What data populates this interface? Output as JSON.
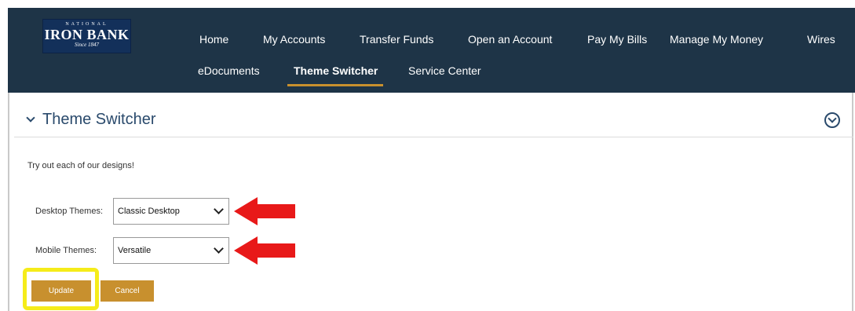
{
  "colors": {
    "nav_background": "#1e3447",
    "accent": "#c8902e",
    "title_text": "#2a4a6c",
    "annotation_arrow": "#e81919",
    "annotation_highlight": "#f5ec1a"
  },
  "brand": {
    "line1": "NATIONAL",
    "line2": "IRON BANK",
    "line3": "Since 1847"
  },
  "nav": {
    "items": [
      {
        "label": "Home"
      },
      {
        "label": "My Accounts"
      },
      {
        "label": "Transfer Funds"
      },
      {
        "label": "Open an Account"
      },
      {
        "label": "Pay My Bills"
      },
      {
        "label": "Manage My Money"
      },
      {
        "label": "Wires"
      },
      {
        "label": "eDocuments"
      },
      {
        "label": "Theme Switcher",
        "active": true
      },
      {
        "label": "Service Center"
      }
    ]
  },
  "panel": {
    "title": "Theme Switcher",
    "expand_icon": "chevron-down-icon",
    "collapse_icon": "circle-chevron-down-icon"
  },
  "form": {
    "intro": "Try out each of our designs!",
    "desktop": {
      "label": "Desktop Themes:",
      "value": "Classic Desktop"
    },
    "mobile": {
      "label": "Mobile Themes:",
      "value": "Versatile"
    },
    "update_label": "Update",
    "cancel_label": "Cancel"
  }
}
